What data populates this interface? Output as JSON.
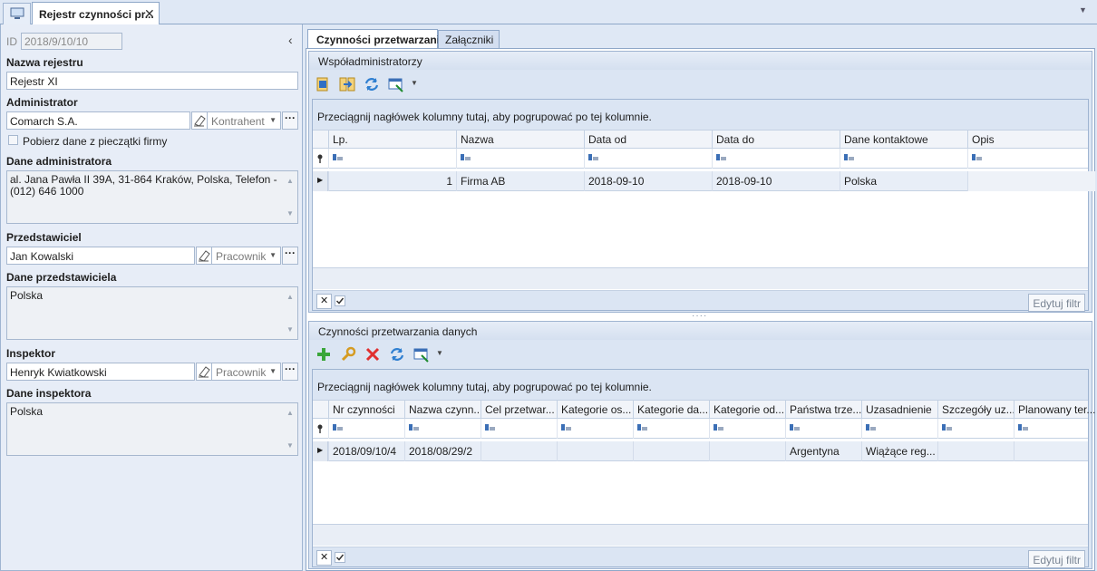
{
  "window": {
    "tab_title": "Rejestr czynności pr...",
    "home_icon": "monitor-icon"
  },
  "left": {
    "id_label": "ID",
    "id_value": "2018/9/10/10",
    "registry_name_label": "Nazwa rejestru",
    "registry_name_value": "Rejestr XI",
    "admin_label": "Administrator",
    "admin_value": "Comarch S.A.",
    "admin_type": "Kontrahent",
    "stamp_checkbox_label": "Pobierz dane z pieczątki firmy",
    "stamp_checked": false,
    "admin_data_label": "Dane administratora",
    "admin_data_value": "al. Jana Pawła II 39A, 31-864 Kraków, Polska, Telefon - (012) 646 1000",
    "rep_label": "Przedstawiciel",
    "rep_value": "Jan Kowalski",
    "rep_type": "Pracownik",
    "rep_data_label": "Dane przedstawiciela",
    "rep_data_value": "Polska",
    "inspector_label": "Inspektor",
    "inspector_value": "Henryk Kwiatkowski",
    "inspector_type": "Pracownik",
    "inspector_data_label": "Dane inspektora",
    "inspector_data_value": "Polska",
    "more_button": "···"
  },
  "tabs": [
    "Czynności przetwarzania",
    "Załączniki"
  ],
  "coadmins": {
    "title": "Współadministratorzy",
    "group_hint": "Przeciągnij nagłówek kolumny tutaj, aby pogrupować po tej kolumnie.",
    "columns": [
      "Lp.",
      "Nazwa",
      "Data od",
      "Data do",
      "Dane kontaktowe",
      "Opis"
    ],
    "rows": [
      [
        "1",
        "Firma AB",
        "2018-09-10",
        "2018-09-10",
        "Polska",
        ""
      ]
    ],
    "edit_filter": "Edytuj filtr"
  },
  "activities": {
    "title": "Czynności przetwarzania danych",
    "group_hint": "Przeciągnij nagłówek kolumny tutaj, aby pogrupować po tej kolumnie.",
    "columns": [
      "Nr czynności",
      "Nazwa czynn...",
      "Cel przetwar...",
      "Kategorie os...",
      "Kategorie da...",
      "Kategorie od...",
      "Państwa trze...",
      "Uzasadnienie",
      "Szczegóły uz...",
      "Planowany ter..."
    ],
    "rows": [
      [
        "2018/09/10/4",
        "2018/08/29/2",
        "",
        "",
        "",
        "",
        "Argentyna",
        "Wiążące reg...",
        "",
        ""
      ]
    ],
    "edit_filter": "Edytuj filtr"
  },
  "splitter": "····"
}
